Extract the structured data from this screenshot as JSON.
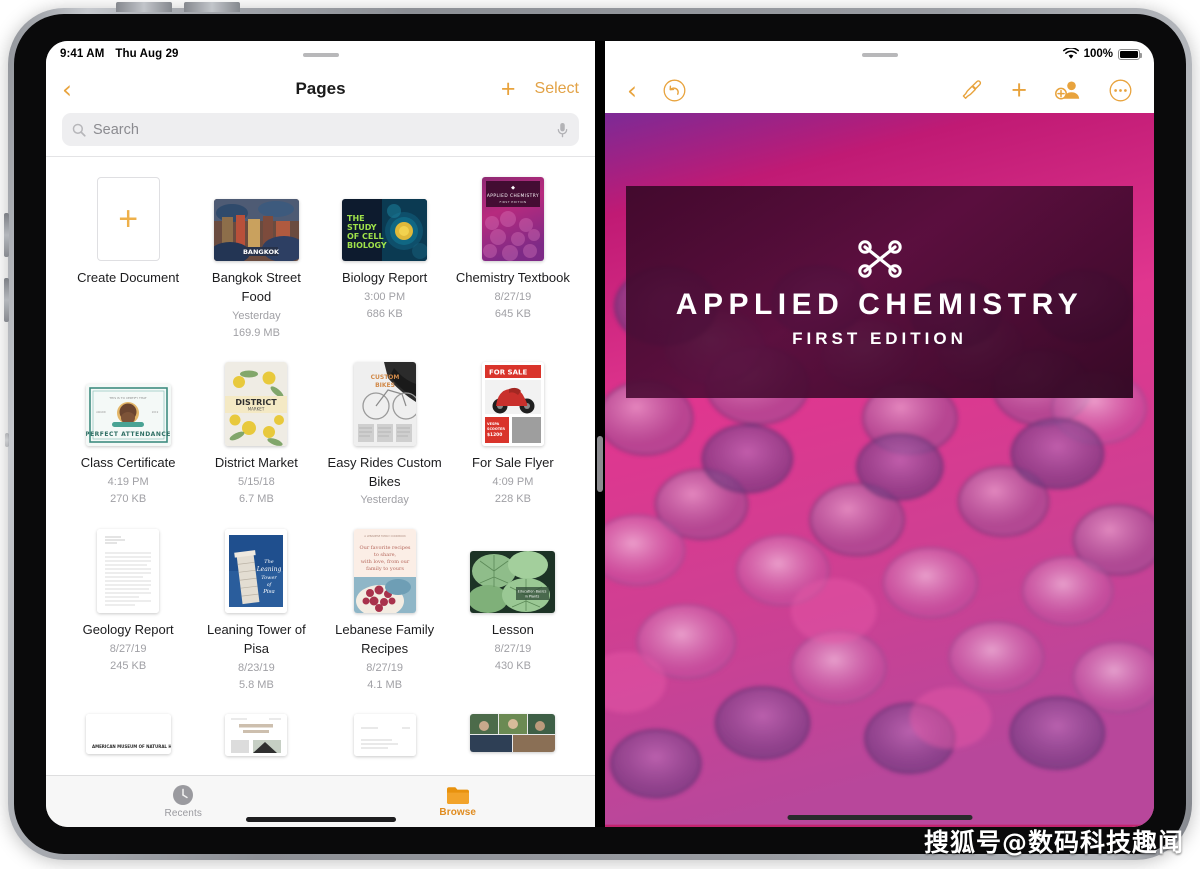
{
  "device": {
    "type": "ipad-pro",
    "orientation": "landscape"
  },
  "left_pane": {
    "statusbar": {
      "time": "9:41 AM",
      "date": "Thu Aug 29"
    },
    "navbar": {
      "back_icon": "chevron-left-icon",
      "title": "Pages",
      "add_icon": "plus-icon",
      "select_label": "Select"
    },
    "search": {
      "placeholder": "Search",
      "value": "",
      "search_icon": "magnifier-icon",
      "dictation_icon": "microphone-icon"
    },
    "documents": [
      {
        "name": "create",
        "title": "Create Document",
        "date": "",
        "size": "",
        "thumb": "plus-tile"
      },
      {
        "name": "bangkok-street-food",
        "title": "Bangkok Street Food",
        "date": "Yesterday",
        "size": "169.9 MB",
        "thumb": "photo-market"
      },
      {
        "name": "biology-report",
        "title": "Biology Report",
        "date": "3:00 PM",
        "size": "686 KB",
        "thumb": "cell-biology"
      },
      {
        "name": "chemistry-textbook",
        "title": "Chemistry Textbook",
        "date": "8/27/19",
        "size": "645 KB",
        "thumb": "applied-chemistry"
      },
      {
        "name": "class-certificate",
        "title": "Class Certificate",
        "date": "4:19 PM",
        "size": "270 KB",
        "thumb": "certificate"
      },
      {
        "name": "district-market",
        "title": "District Market",
        "date": "5/15/18",
        "size": "6.7 MB",
        "thumb": "lemons"
      },
      {
        "name": "easy-rides-custom-bikes",
        "title": "Easy Rides Custom Bikes",
        "date": "Yesterday",
        "size": "",
        "thumb": "bicycle"
      },
      {
        "name": "for-sale-flyer",
        "title": "For Sale Flyer",
        "date": "4:09 PM",
        "size": "228 KB",
        "thumb": "scooter"
      },
      {
        "name": "geology-report",
        "title": "Geology Report",
        "date": "8/27/19",
        "size": "245 KB",
        "thumb": "text-page"
      },
      {
        "name": "leaning-tower-of-pisa",
        "title": "Leaning Tower of Pisa",
        "date": "8/23/19",
        "size": "5.8 MB",
        "thumb": "pisa"
      },
      {
        "name": "lebanese-family-recipes",
        "title": "Lebanese Family Recipes",
        "date": "8/27/19",
        "size": "4.1 MB",
        "thumb": "recipes"
      },
      {
        "name": "lesson",
        "title": "Lesson",
        "date": "8/27/19",
        "size": "430 KB",
        "thumb": "leaves"
      }
    ],
    "partial_row": [
      {
        "name": "museum-doc",
        "thumb": "museum-page"
      },
      {
        "name": "report-doc",
        "thumb": "report-page"
      },
      {
        "name": "letter-doc",
        "thumb": "letter-page"
      },
      {
        "name": "photos-doc",
        "thumb": "photo-strip"
      }
    ],
    "tabbar": [
      {
        "name": "recents",
        "label": "Recents",
        "icon": "clock-icon",
        "active": false
      },
      {
        "name": "browse",
        "label": "Browse",
        "icon": "folder-icon",
        "active": true
      }
    ]
  },
  "right_pane": {
    "statusbar": {
      "wifi_icon": "wifi-icon",
      "battery_text": "100%",
      "battery_icon": "battery-full-icon"
    },
    "toolbar": {
      "left": [
        {
          "name": "back",
          "icon": "chevron-left-icon",
          "label": ""
        },
        {
          "name": "undo",
          "icon": "undo-circle-icon",
          "label": ""
        }
      ],
      "right": [
        {
          "name": "format",
          "icon": "paintbrush-icon",
          "label": ""
        },
        {
          "name": "insert",
          "icon": "plus-icon",
          "label": ""
        },
        {
          "name": "collaborate",
          "icon": "add-person-icon",
          "label": ""
        },
        {
          "name": "more",
          "icon": "ellipsis-circle-icon",
          "label": ""
        }
      ]
    },
    "document": {
      "title": "APPLIED CHEMISTRY",
      "subtitle": "FIRST EDITION",
      "logo_icon": "molecule-icon",
      "background": "pink-circles-photo"
    }
  },
  "colors": {
    "accent_orange": "#E8A33D",
    "tab_active": "#E08C20",
    "title_block": "#3A0828",
    "doc_bg_pink": "#C2246F",
    "meta_gray": "#A0A0A5"
  },
  "watermark": {
    "text": "搜狐号@数码科技趣闻"
  }
}
